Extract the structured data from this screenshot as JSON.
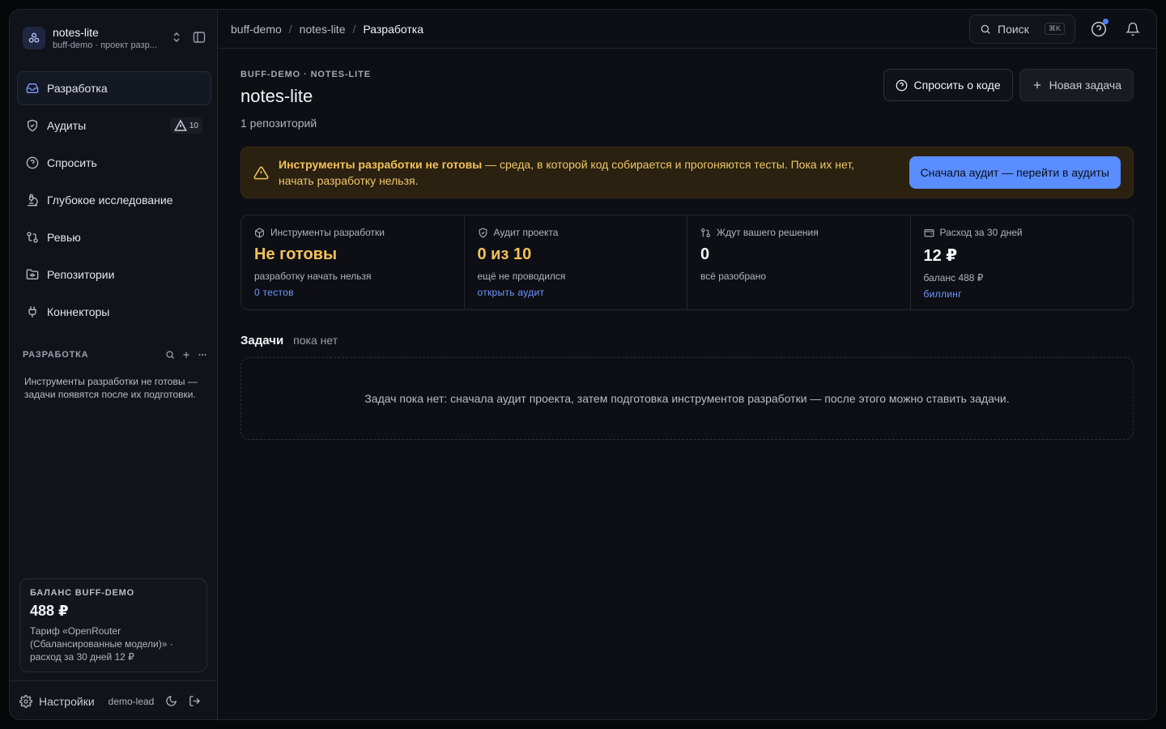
{
  "project": {
    "name": "notes-lite",
    "subtitle": "buff-demo · проект разр..."
  },
  "nav": {
    "items": [
      {
        "label": "Разработка",
        "icon": "inbox-icon",
        "active": true
      },
      {
        "label": "Аудиты",
        "icon": "shield-icon",
        "badge": "10"
      },
      {
        "label": "Спросить",
        "icon": "question-icon"
      },
      {
        "label": "Глубокое исследование",
        "icon": "microscope-icon"
      },
      {
        "label": "Ревью",
        "icon": "git-compare-icon"
      },
      {
        "label": "Репозитории",
        "icon": "folder-git-icon"
      },
      {
        "label": "Коннекторы",
        "icon": "plug-icon"
      }
    ]
  },
  "section": {
    "title": "РАЗРАБОТКА",
    "note": "Инструменты разработки не готовы — задачи появятся после их подготовки."
  },
  "balance": {
    "title": "БАЛАНС BUFF-DEMO",
    "amount": "488 ₽",
    "desc": "Тариф «OpenRouter (Сбалансированные модели)» · расход за 30 дней 12 ₽"
  },
  "footer": {
    "settings": "Настройки",
    "user": "demo-lead"
  },
  "breadcrumbs": [
    "buff-demo",
    "notes-lite",
    "Разработка"
  ],
  "search": {
    "placeholder": "Поиск",
    "shortcut": "⌘K"
  },
  "header": {
    "eyebrow": "BUFF-DEMO · NOTES-LITE",
    "title": "notes-lite",
    "subtitle": "1 репозиторий",
    "ask_button": "Спросить о коде",
    "new_task_button": "Новая задача"
  },
  "alert": {
    "bold": "Инструменты разработки не готовы",
    "text": " — среда, в которой код собирается и прогоняются тесты. Пока их нет, начать разработку нельзя.",
    "button": "Сначала аудит — перейти в аудиты"
  },
  "stats": [
    {
      "label": "Инструменты разработки",
      "icon": "box-icon",
      "value": "Не готовы",
      "warn": true,
      "desc": "разработку начать нельзя",
      "link": "0 тестов"
    },
    {
      "label": "Аудит проекта",
      "icon": "shield-check-icon",
      "value": "0 из 10",
      "warn": true,
      "desc": "ещё не проводился",
      "link": "открыть аудит"
    },
    {
      "label": "Ждут вашего решения",
      "icon": "git-pull-icon",
      "value": "0",
      "desc": "всё разобрано"
    },
    {
      "label": "Расход за 30 дней",
      "icon": "wallet-icon",
      "value": "12 ₽",
      "desc": "баланс 488 ₽",
      "link": "биллинг"
    }
  ],
  "tasks": {
    "title": "Задачи",
    "subtitle": "пока нет",
    "empty": "Задач пока нет: сначала аудит проекта, затем подготовка инструментов разработки — после этого можно ставить задачи."
  },
  "colors": {
    "accent": "#5a8dff",
    "warning": "#f4c25a",
    "link": "#6f97ff"
  }
}
